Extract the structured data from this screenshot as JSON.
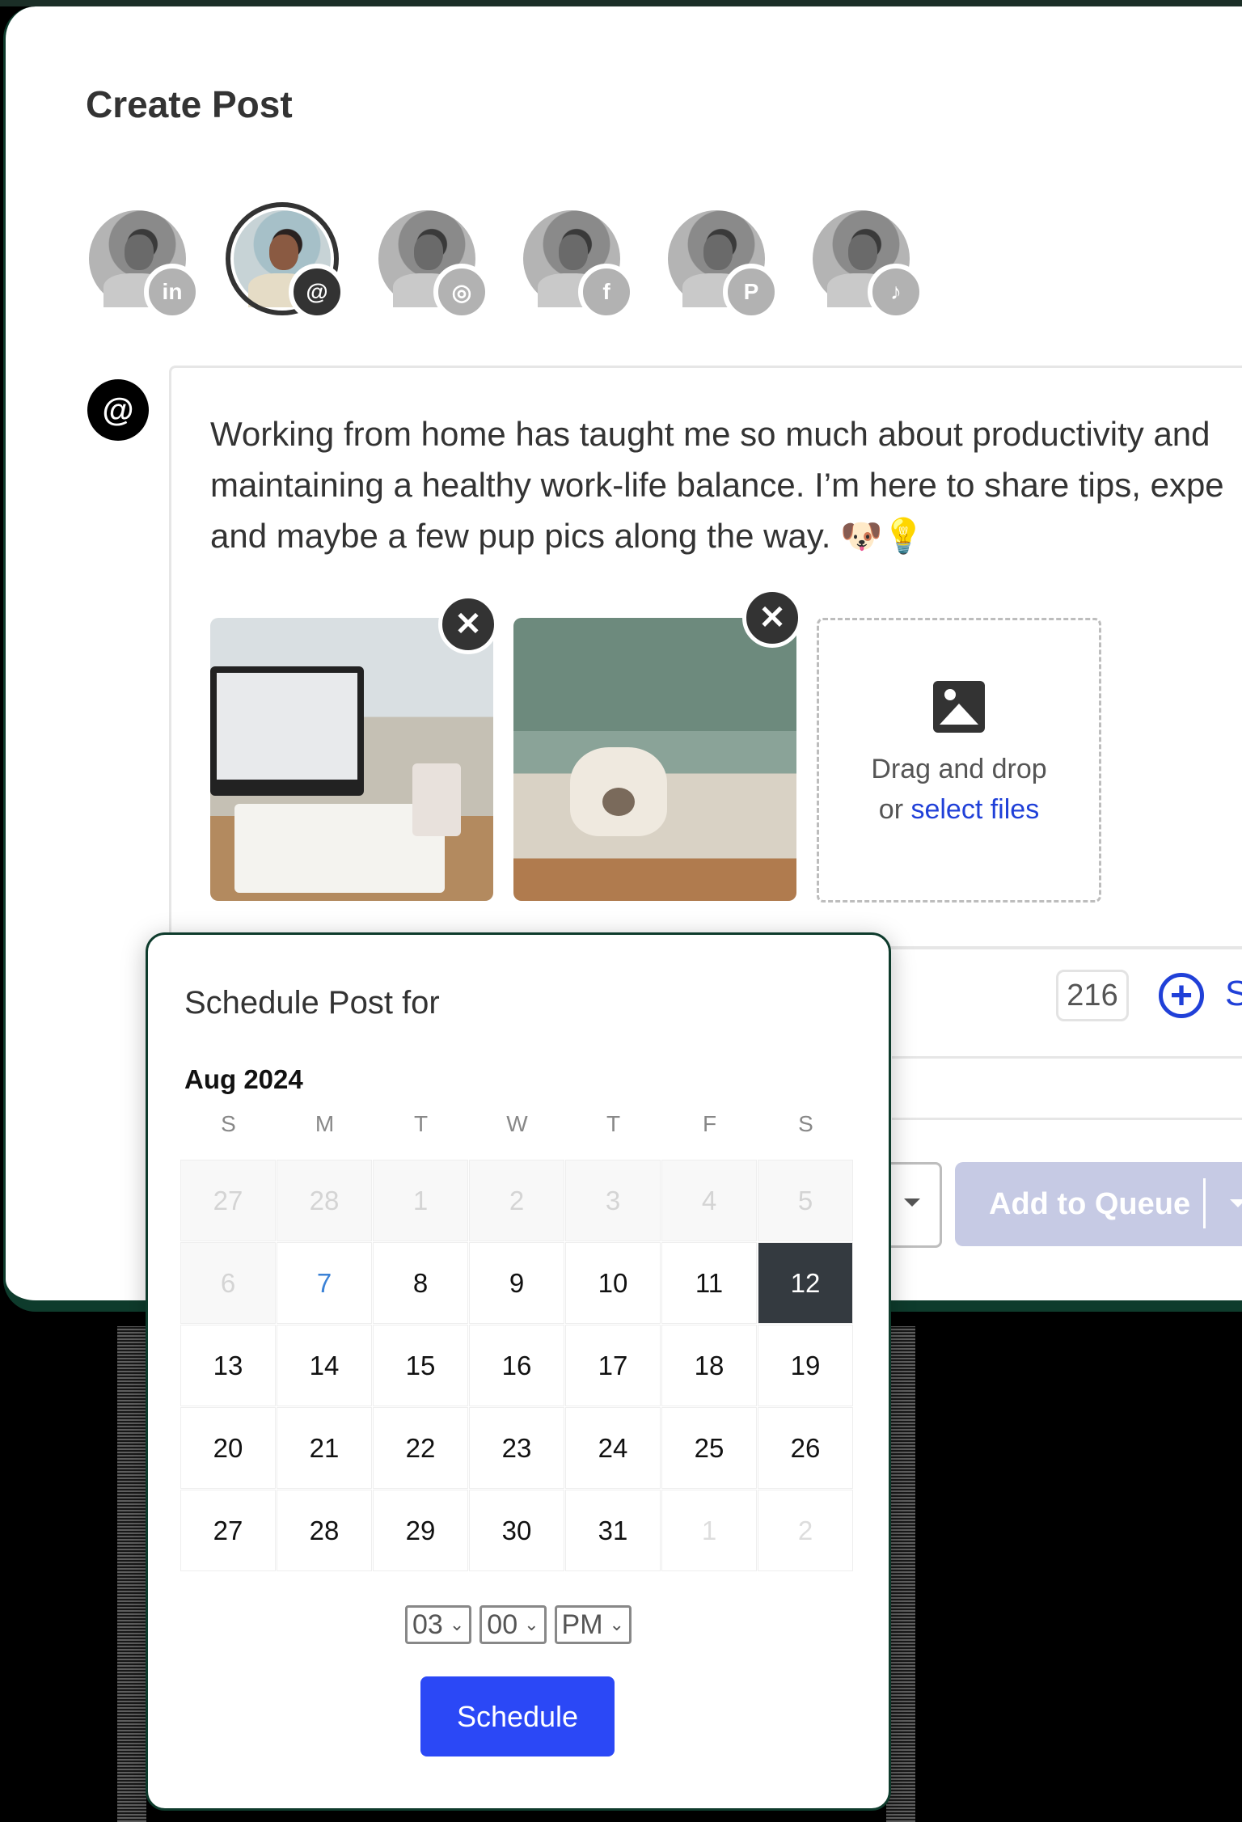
{
  "header": {
    "title": "Create Post"
  },
  "accounts": [
    {
      "network": "LinkedIn",
      "badge_icon": "linkedin-icon",
      "badge_glyph": "in",
      "selected": false
    },
    {
      "network": "Threads",
      "badge_icon": "threads-icon",
      "badge_glyph": "@",
      "selected": true
    },
    {
      "network": "Instagram",
      "badge_icon": "instagram-icon",
      "badge_glyph": "◎",
      "selected": false
    },
    {
      "network": "Facebook",
      "badge_icon": "facebook-icon",
      "badge_glyph": "f",
      "selected": false
    },
    {
      "network": "Pinterest",
      "badge_icon": "pinterest-icon",
      "badge_glyph": "P",
      "selected": false
    },
    {
      "network": "TikTok",
      "badge_icon": "tiktok-icon",
      "badge_glyph": "♪",
      "selected": false
    }
  ],
  "editor": {
    "network_glyph": "@",
    "text": "Working from home has taught me so much about productivity and\nmaintaining a healthy work-life balance. I’m here to share tips, expe\nand maybe a few pup pics along the way. 🐶💡",
    "attachments": [
      {
        "description": "laptop on desk with notebook and mug",
        "remove_glyph": "✕"
      },
      {
        "description": "french bulldog on cushion",
        "remove_glyph": "✕"
      }
    ],
    "dropzone": {
      "line1": "Drag and drop",
      "line2_prefix": "or ",
      "link": "select files"
    },
    "char_count": "216",
    "add_glyph": "+",
    "add_label": "S"
  },
  "footer": {
    "queue_label": "Add to Queue"
  },
  "schedule": {
    "title": "Schedule Post for",
    "month": "Aug 2024",
    "weekdays": [
      "S",
      "M",
      "T",
      "W",
      "T",
      "F",
      "S"
    ],
    "weeks": [
      [
        {
          "d": "27",
          "state": "disabled"
        },
        {
          "d": "28",
          "state": "disabled"
        },
        {
          "d": "1",
          "state": "disabled"
        },
        {
          "d": "2",
          "state": "disabled"
        },
        {
          "d": "3",
          "state": "disabled"
        },
        {
          "d": "4",
          "state": "disabled"
        },
        {
          "d": "5",
          "state": "disabled"
        }
      ],
      [
        {
          "d": "6",
          "state": "disabled"
        },
        {
          "d": "7",
          "state": "today"
        },
        {
          "d": "8",
          "state": ""
        },
        {
          "d": "9",
          "state": ""
        },
        {
          "d": "10",
          "state": ""
        },
        {
          "d": "11",
          "state": ""
        },
        {
          "d": "12",
          "state": "selected"
        }
      ],
      [
        {
          "d": "13",
          "state": ""
        },
        {
          "d": "14",
          "state": ""
        },
        {
          "d": "15",
          "state": ""
        },
        {
          "d": "16",
          "state": ""
        },
        {
          "d": "17",
          "state": ""
        },
        {
          "d": "18",
          "state": ""
        },
        {
          "d": "19",
          "state": ""
        }
      ],
      [
        {
          "d": "20",
          "state": ""
        },
        {
          "d": "21",
          "state": ""
        },
        {
          "d": "22",
          "state": ""
        },
        {
          "d": "23",
          "state": ""
        },
        {
          "d": "24",
          "state": ""
        },
        {
          "d": "25",
          "state": ""
        },
        {
          "d": "26",
          "state": ""
        }
      ],
      [
        {
          "d": "27",
          "state": ""
        },
        {
          "d": "28",
          "state": ""
        },
        {
          "d": "29",
          "state": ""
        },
        {
          "d": "30",
          "state": ""
        },
        {
          "d": "31",
          "state": ""
        },
        {
          "d": "1",
          "state": "other"
        },
        {
          "d": "2",
          "state": "other"
        }
      ]
    ],
    "hour": "03",
    "minute": "00",
    "meridiem": "PM",
    "chevron": "⌄",
    "button_label": "Schedule"
  },
  "colors": {
    "accent": "#2b48f6",
    "frame": "#0e3b2c",
    "selected_day": "#343a40",
    "today": "#3b82d6",
    "queue_disabled": "#c6cae4"
  }
}
